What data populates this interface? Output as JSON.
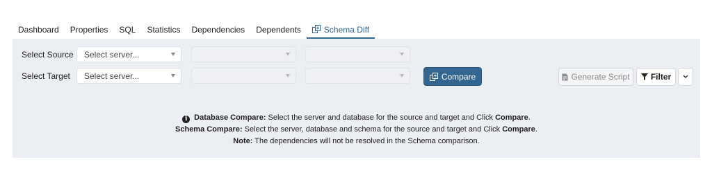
{
  "tabs": [
    "Dashboard",
    "Properties",
    "SQL",
    "Statistics",
    "Dependencies",
    "Dependents",
    "Schema Diff"
  ],
  "active_tab": "Schema Diff",
  "source": {
    "label": "Select Source",
    "server_placeholder": "Select server...",
    "database_value": "",
    "schema_value": ""
  },
  "target": {
    "label": "Select Target",
    "server_placeholder": "Select server...",
    "database_value": "",
    "schema_value": ""
  },
  "buttons": {
    "compare": "Compare",
    "generate_script": "Generate Script",
    "filter": "Filter"
  },
  "info": {
    "line1_bold": "Database Compare:",
    "line1_text": " Select the server and database for the source and target and Click ",
    "line1_end_bold": "Compare",
    "line1_end": ".",
    "line2_bold": "Schema Compare:",
    "line2_text": " Select the server, database and schema for the source and target and Click ",
    "line2_end_bold": "Compare",
    "line2_end": ".",
    "line3_bold": "Note:",
    "line3_text": " The dependencies will not be resolved in the Schema comparison."
  },
  "colors": {
    "accent": "#326690",
    "panel_bg": "#ebeef3"
  }
}
